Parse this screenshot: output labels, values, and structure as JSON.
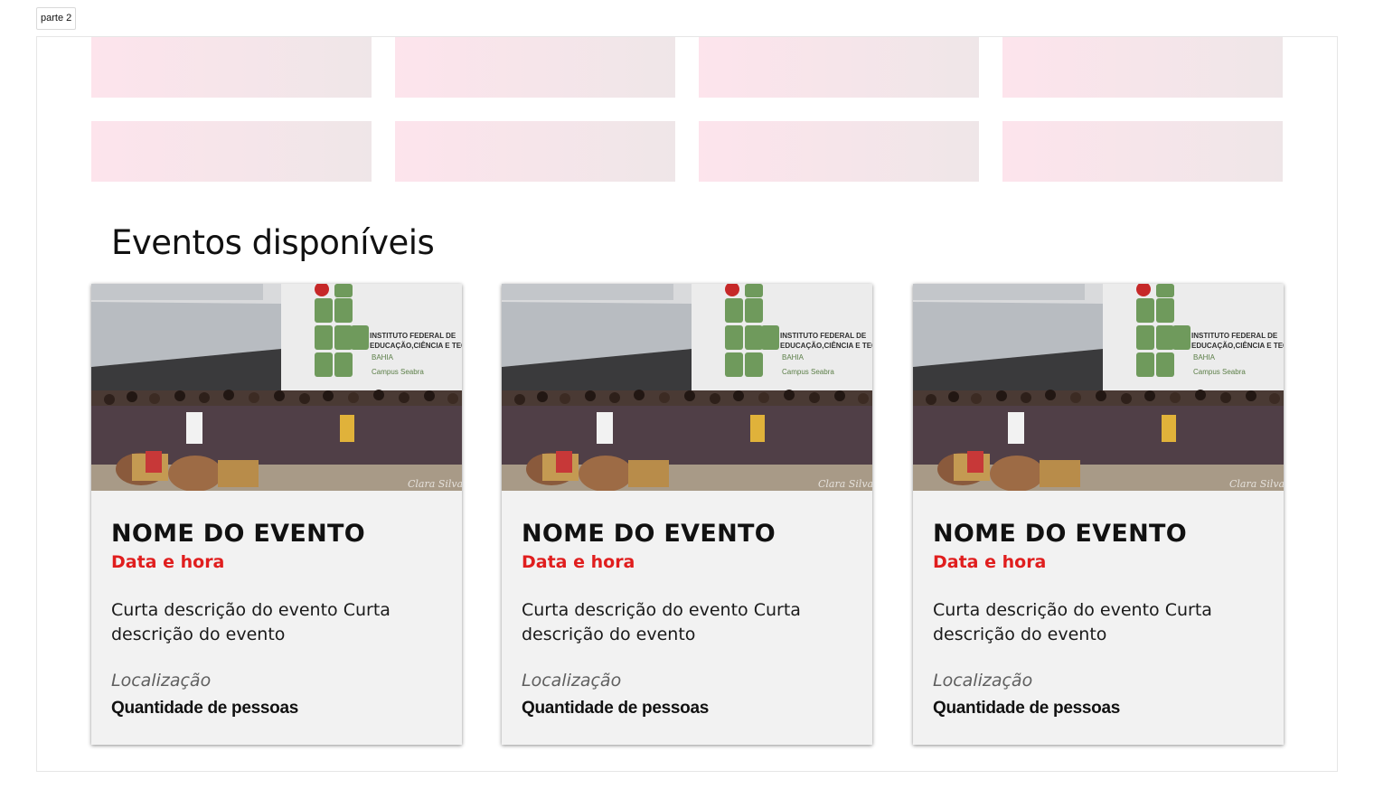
{
  "frame_label": "parte 2",
  "section_title": "Eventos disponíveis",
  "photo_sign": {
    "line1": "INSTITUTO FEDERAL DE",
    "line2": "EDUCAÇÃO,CIÊNCIA E TECNOLOGIA",
    "line3": "BAHIA",
    "line4": "Campus Seabra",
    "watermark": "Clara Silva"
  },
  "cards": [
    {
      "title": "NOME DO EVENTO",
      "date": "Data e hora",
      "description": "Curta descrição do evento Curta descrição do evento",
      "location": "Localização",
      "capacity": "Quantidade de pessoas"
    },
    {
      "title": "NOME DO EVENTO",
      "date": "Data e hora",
      "description": "Curta descrição do evento Curta descrição do evento",
      "location": "Localização",
      "capacity": "Quantidade de pessoas"
    },
    {
      "title": "NOME DO EVENTO",
      "date": "Data e hora",
      "description": "Curta descrição do evento Curta descrição do evento",
      "location": "Localização",
      "capacity": "Quantidade de pessoas"
    }
  ],
  "colors": {
    "accent_red": "#e01e1e",
    "card_background": "#f2f2f2",
    "tile_gradient_start": "#fde4ec",
    "tile_gradient_end": "#efe6e8",
    "logo_green": "#6f9a5c",
    "logo_red": "#c62828"
  }
}
